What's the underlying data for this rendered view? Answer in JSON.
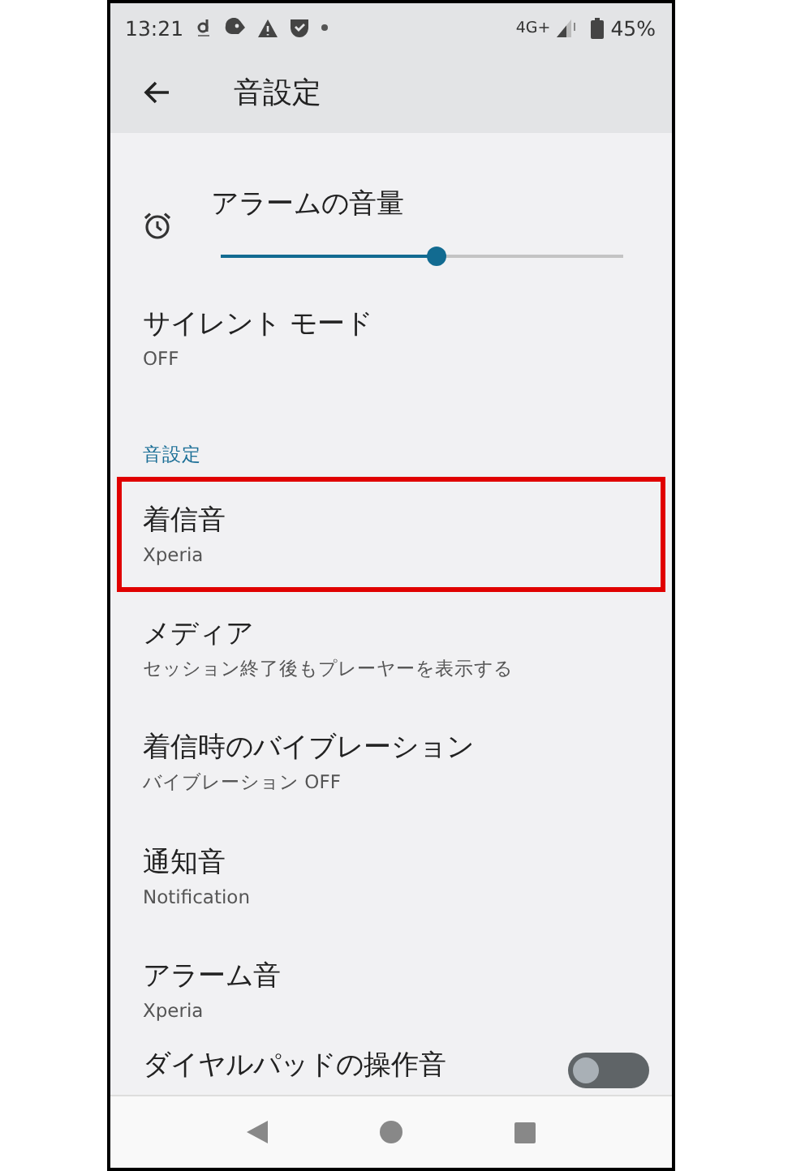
{
  "status_bar": {
    "time": "13:21",
    "network": "4G+",
    "battery": "45%"
  },
  "app_bar": {
    "title": "音設定"
  },
  "items": [
    {
      "kind": "slider",
      "title": "アラームの音量",
      "level": 0.535
    },
    {
      "kind": "text",
      "title": "サイレント モード",
      "summary": "OFF",
      "highlighted": false
    },
    {
      "kind": "header",
      "title": "音設定"
    },
    {
      "kind": "text",
      "title": "着信音",
      "summary": "Xperia",
      "highlighted": true
    },
    {
      "kind": "text",
      "title": "メディア",
      "summary": "セッション終了後もプレーヤーを表示する",
      "highlighted": false
    },
    {
      "kind": "text",
      "title": "着信時のバイブレーション",
      "summary": "バイブレーション OFF",
      "highlighted": false
    },
    {
      "kind": "text",
      "title": "通知音",
      "summary": "Notification",
      "highlighted": false
    },
    {
      "kind": "text",
      "title": "アラーム音",
      "summary": "Xperia",
      "highlighted": false
    },
    {
      "kind": "toggle",
      "title": "ダイヤルパッドの操作音",
      "on": false
    }
  ]
}
